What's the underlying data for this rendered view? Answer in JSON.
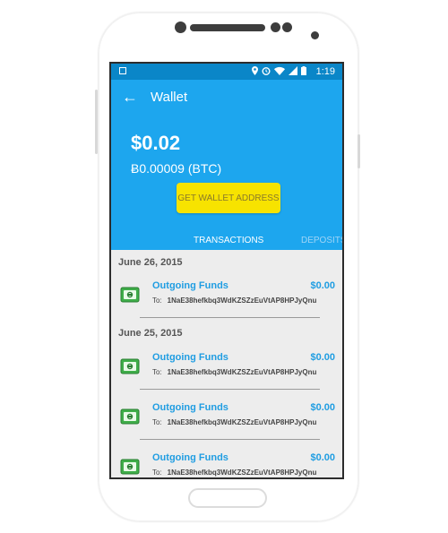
{
  "status_bar": {
    "time": "1:19"
  },
  "app_bar": {
    "back_icon": "arrow-left-icon",
    "title": "Wallet"
  },
  "balance": {
    "fiat": "$0.02",
    "btc": "Ƀ0.00009  (BTC)"
  },
  "wallet_button": {
    "label": "GET WALLET ADDRESS"
  },
  "tabs": [
    {
      "label": "TRANSACTIONS",
      "active": true
    },
    {
      "label": "DEPOSITS",
      "active": false
    }
  ],
  "transactions": {
    "to_label": "To:",
    "groups": [
      {
        "date": "June 26, 2015",
        "items": [
          {
            "title": "Outgoing Funds",
            "amount": "$0.00",
            "address": "1NaE38hefkbq3WdKZSZzEuVtAP8HPJyQnu"
          }
        ]
      },
      {
        "date": "June 25, 2015",
        "items": [
          {
            "title": "Outgoing Funds",
            "amount": "$0.00",
            "address": "1NaE38hefkbq3WdKZSZzEuVtAP8HPJyQnu"
          },
          {
            "title": "Outgoing Funds",
            "amount": "$0.00",
            "address": "1NaE38hefkbq3WdKZSZzEuVtAP8HPJyQnu"
          },
          {
            "title": "Outgoing Funds",
            "amount": "$0.00",
            "address": "1NaE38hefkbq3WdKZSZzEuVtAP8HPJyQnu"
          }
        ]
      }
    ]
  },
  "colors": {
    "primary": "#1da6ee",
    "status_bar": "#0a86c8",
    "button": "#f7e300",
    "link": "#1f9de2",
    "list_bg": "#ededed"
  }
}
